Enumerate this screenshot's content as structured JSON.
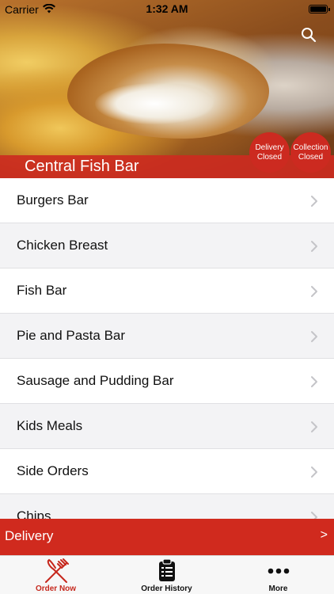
{
  "status_bar": {
    "carrier": "Carrier",
    "time": "1:32 AM",
    "wifi_icon": "wifi-icon",
    "battery_icon": "battery-icon"
  },
  "header": {
    "title": "Central Fish Bar",
    "search_icon": "search-icon",
    "delivery_status": {
      "line1": "Delivery",
      "line2": "Closed"
    },
    "collection_status": {
      "line1": "Collection",
      "line2": "Closed"
    },
    "accent_color": "#cc2a20"
  },
  "menu": {
    "items": [
      {
        "label": "Burgers Bar"
      },
      {
        "label": "Chicken Breast"
      },
      {
        "label": "Fish Bar"
      },
      {
        "label": "Pie and Pasta Bar"
      },
      {
        "label": "Sausage and Pudding Bar"
      },
      {
        "label": "Kids Meals"
      },
      {
        "label": "Side Orders"
      },
      {
        "label": "Chips"
      }
    ],
    "chevron_icon": "chevron-right-icon"
  },
  "delivery_bar": {
    "label": "Delivery",
    "arrow": ">",
    "color": "#d02a1e"
  },
  "tabbar": {
    "tabs": [
      {
        "label": "Order Now",
        "icon": "fork-knife-icon",
        "active": true
      },
      {
        "label": "Order History",
        "icon": "clipboard-icon",
        "active": false
      },
      {
        "label": "More",
        "icon": "more-dots-icon",
        "active": false
      }
    ],
    "active_color": "#c6281d"
  }
}
